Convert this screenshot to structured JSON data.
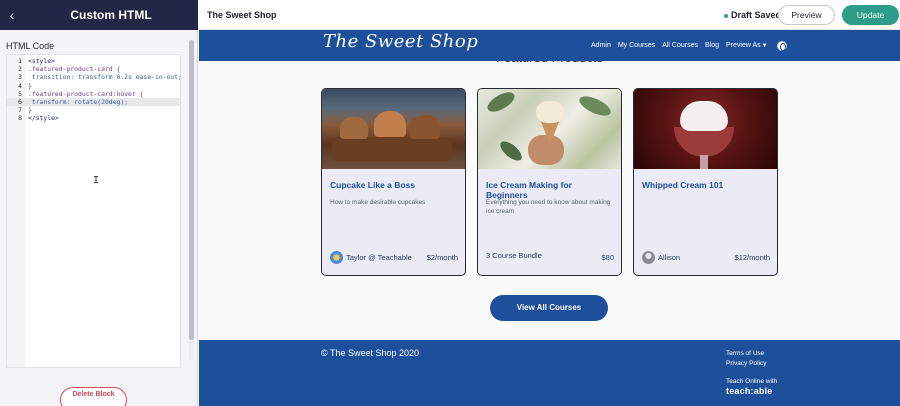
{
  "editor": {
    "panel_title": "Custom HTML",
    "back_icon": "chevron-left-icon",
    "section_label": "HTML Code",
    "delete_label": "Delete Block",
    "cursor": "I"
  },
  "code": {
    "lines": [
      {
        "n": "1",
        "text": "<style>"
      },
      {
        "n": "2",
        "text": ".featured-product-card {"
      },
      {
        "n": "3",
        "text": " transition: transform 0.2s ease-in-out;"
      },
      {
        "n": "4",
        "text": "}"
      },
      {
        "n": "5",
        "text": ".featured-product-card:hover {"
      },
      {
        "n": "6",
        "text": " transform: rotate(20deg);"
      },
      {
        "n": "7",
        "text": "}"
      },
      {
        "n": "8",
        "text": "</style>"
      }
    ]
  },
  "topbar": {
    "site_name": "The Sweet Shop",
    "status": "Draft Saved",
    "preview_label": "Preview",
    "update_label": "Update"
  },
  "site": {
    "logo": "The Sweet Shop",
    "nav": [
      "Admin",
      "My Courses",
      "All Courses",
      "Blog",
      "Preview As"
    ],
    "section_title": "Featured Products",
    "cards": [
      {
        "title": "Cupcake Like a Boss",
        "desc": "How to make desirable cupcakes",
        "author": "Taylor @ Teachable",
        "price": "$2/month"
      },
      {
        "title": "Ice Cream Making for Beginners",
        "desc": "Everything you need to know about making ice cream",
        "author": "3 Course Bundle",
        "price": "$80"
      },
      {
        "title": "Whipped Cream 101",
        "desc": "",
        "author": "Allison",
        "price": "$12/month"
      }
    ],
    "view_all_label": "View All Courses",
    "footer": {
      "copyright": "© The Sweet Shop 2020",
      "links": [
        "Terms of Use",
        "Privacy Policy"
      ],
      "teach_online": "Teach Online with",
      "brand": "teach:able"
    }
  },
  "colors": {
    "editor_header": "#232645",
    "brand_blue": "#1d4f9a",
    "update_green": "#2d9c8a",
    "delete_red": "#d4495a"
  }
}
